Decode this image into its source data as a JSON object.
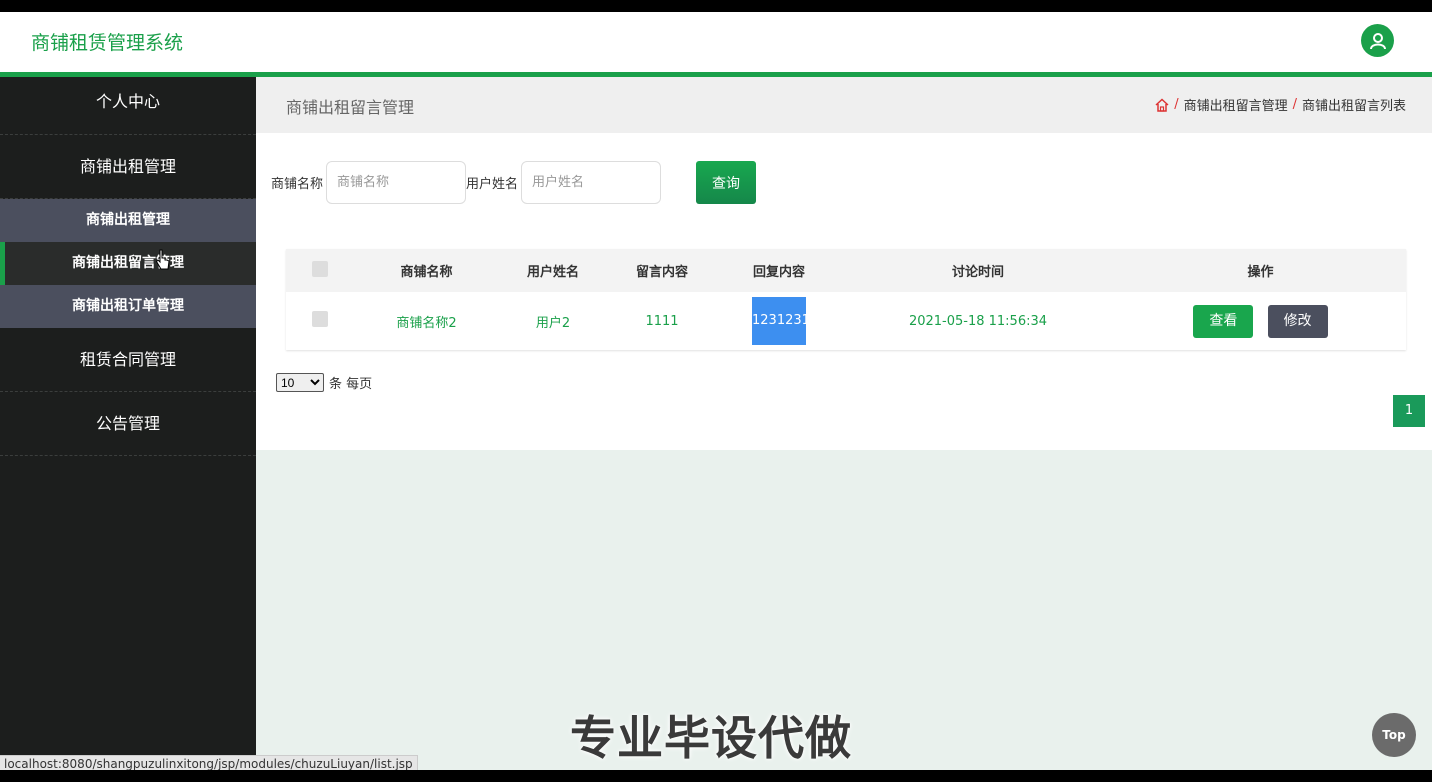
{
  "header": {
    "brand": "商铺租赁管理系统"
  },
  "sidebar": {
    "groups": [
      {
        "label": "个人中心"
      },
      {
        "label": "商铺出租管理"
      },
      {
        "label": "租赁合同管理"
      },
      {
        "label": "公告管理"
      }
    ],
    "sub_items": [
      {
        "label": "商铺出租管理"
      },
      {
        "label": "商铺出租留言管理"
      },
      {
        "label": "商铺出租订单管理"
      }
    ]
  },
  "crumbbar": {
    "title": "商铺出租留言管理",
    "crumbs": [
      "商铺出租留言管理",
      "商铺出租留言列表"
    ],
    "separator": "/"
  },
  "search": {
    "shop_label": "商铺名称",
    "shop_placeholder": "商铺名称",
    "user_label": "用户姓名",
    "user_placeholder": "用户姓名",
    "button": "查询"
  },
  "table": {
    "columns": [
      "商铺名称",
      "用户姓名",
      "留言内容",
      "回复内容",
      "讨论时间",
      "操作"
    ],
    "rows": [
      {
        "shop": "商铺名称2",
        "user": "用户2",
        "message": "1111",
        "reply": "1231231",
        "time": "2021-05-18 11:56:34",
        "view": "查看",
        "edit": "修改"
      }
    ]
  },
  "pager": {
    "size": "10",
    "size_suffix": "条 每页",
    "current_page": "1"
  },
  "watermark": "专业毕设代做",
  "top_button": "Top",
  "status_url": "localhost:8080/shangpuzulinxitong/jsp/modules/chuzuLiuyan/list.jsp",
  "colors": {
    "accent": "#1aa04a",
    "sidebar": "#1c1e1d",
    "sub_item": "#4b4f5e"
  }
}
